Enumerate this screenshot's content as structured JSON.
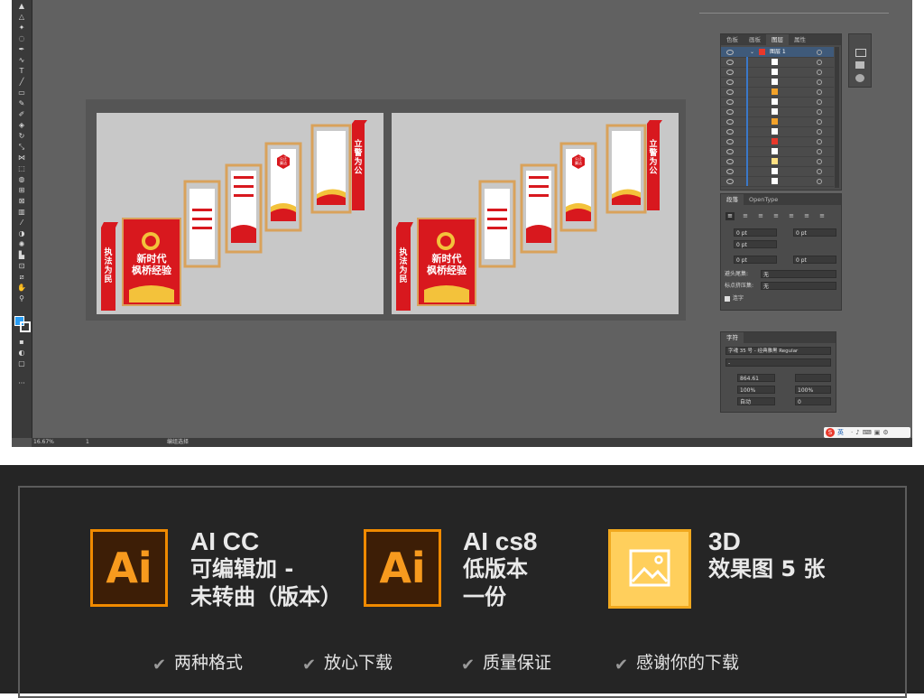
{
  "toolbar": {
    "tools": [
      "selection",
      "direct-selection",
      "magic-wand",
      "lasso",
      "pen",
      "curvature",
      "type",
      "line",
      "rectangle",
      "paintbrush",
      "shaper",
      "pencil",
      "eraser",
      "rotate",
      "scale",
      "width",
      "free-transform",
      "shape-builder",
      "perspective",
      "mesh",
      "gradient",
      "eyedropper",
      "blend",
      "symbol-sprayer",
      "column-graph",
      "artboard",
      "slice",
      "hand",
      "zoom",
      "fill-stroke",
      "color-mode",
      "draw-mode",
      "screen-mode",
      "more-tools"
    ]
  },
  "status": {
    "zoom": "16.67%",
    "artboard_index": "1",
    "mode": "编组选择"
  },
  "boards": [
    {
      "top_vertical": "立警为公",
      "bottom_vertical": "执法为民",
      "main_line1": "新时代",
      "main_line2": "枫桥经验",
      "hex_text": "公正\n廉洁"
    },
    {
      "top_vertical": "立警为公",
      "bottom_vertical": "执法为民",
      "main_line1": "新时代",
      "main_line2": "枫桥经验",
      "hex_text": "公正\n廉洁"
    }
  ],
  "layers_panel": {
    "tabs": [
      "色板",
      "画板",
      "图层",
      "属性"
    ],
    "active_tab": "图层",
    "top_layer": "图层 1",
    "sublayer_colors": [
      "#ffffff",
      "#ffffff",
      "#ffffff",
      "#f2a22a",
      "#ffffff",
      "#ffffff",
      "#f2a22a",
      "#ffffff",
      "#e8382b",
      "#ffffff",
      "#ffe082",
      "#ffffff",
      "#ffffff"
    ]
  },
  "paragraph_panel": {
    "tabs": [
      "段落",
      "OpenType"
    ],
    "indent_left": "0 pt",
    "indent_right": "0 pt",
    "indent_first": "0 pt",
    "space_before": "0 pt",
    "space_after": "0 pt",
    "kinsoku_label": "避头尾集:",
    "kinsoku_value": "无",
    "mojikumi_label": "标点挤压集:",
    "mojikumi_value": "无",
    "hyphenate_label": "连字"
  },
  "character_panel": {
    "tab": "字符",
    "font": "字魂 35 号 - 经典雅黑 Regular",
    "style": "-",
    "size": "864.61",
    "vertical_scale": "100%",
    "horizontal_scale": "100%",
    "tracking": "0",
    "leading_auto": "自动"
  },
  "ime_bar": {
    "label": "英"
  },
  "features": [
    {
      "badge": "Ai",
      "title": "AI CC",
      "lines": [
        "可编辑加 -",
        "未转曲（版本）"
      ]
    },
    {
      "badge": "Ai",
      "title": "AI cs8",
      "lines": [
        "低版本",
        "一份"
      ]
    },
    {
      "badge": "image",
      "title": "3D",
      "lines": [
        "效果图 5 张"
      ]
    }
  ],
  "checklist": [
    "两种格式",
    "放心下载",
    "质量保证",
    "感谢你的下载"
  ],
  "colors": {
    "accent_orange": "#f08a00",
    "ai_bg": "#3d1e06",
    "poster_red": "#d8181e",
    "poster_gold": "#d9a25b",
    "banner_bg": "#252525",
    "photo_tile": "#ffcf5c"
  }
}
